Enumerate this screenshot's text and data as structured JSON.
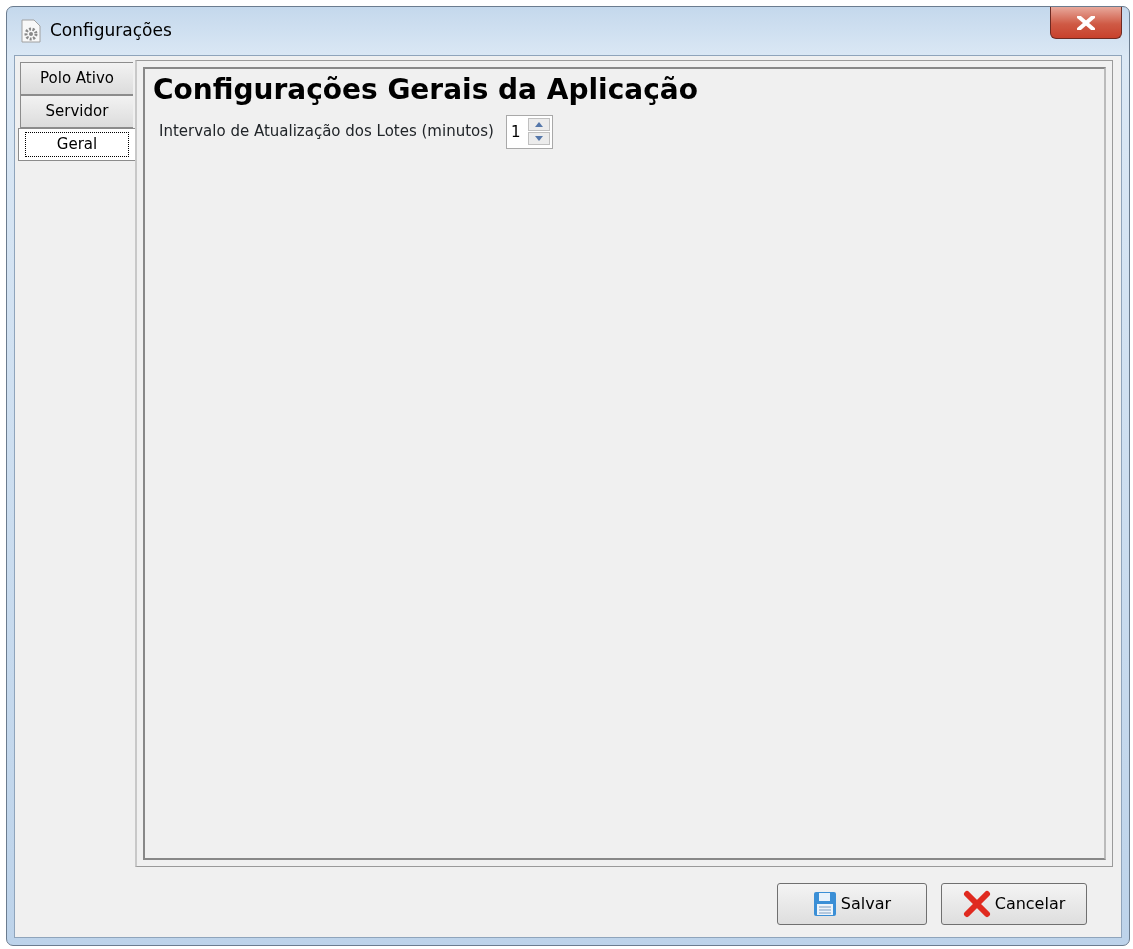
{
  "window": {
    "title": "Configurações"
  },
  "tabs": [
    {
      "label": "Polo Ativo",
      "selected": false
    },
    {
      "label": "Servidor",
      "selected": false
    },
    {
      "label": "Geral",
      "selected": true
    }
  ],
  "panel": {
    "heading": "Configurações Gerais da Aplicação",
    "fields": [
      {
        "label": "Intervalo de Atualização dos Lotes (minutos)",
        "value": "1"
      }
    ]
  },
  "buttons": [
    {
      "label": "Salvar",
      "kind": "save"
    },
    {
      "label": "Cancelar",
      "kind": "cancel"
    }
  ]
}
